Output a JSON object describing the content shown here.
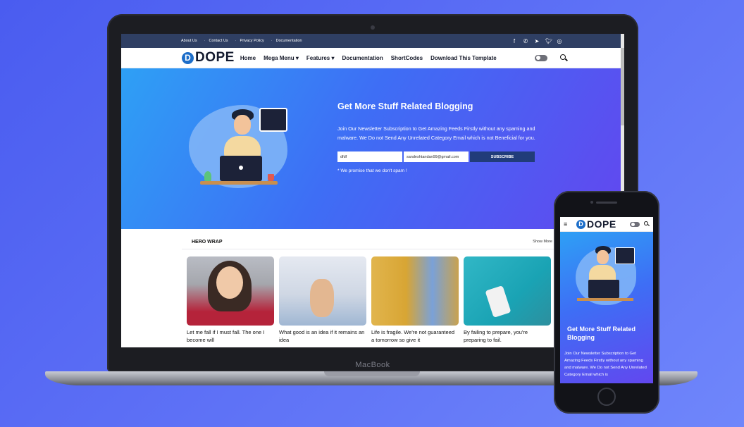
{
  "laptop": {
    "brand": "MacBook"
  },
  "site": {
    "topbar": {
      "links": [
        "About Us",
        "Contact Us",
        "Privacy Policy",
        "Documentation"
      ],
      "socials": [
        "facebook-icon",
        "whatsapp-icon",
        "telegram-icon",
        "twitter-icon",
        "instagram-icon"
      ]
    },
    "logo": {
      "mark": "D",
      "text": "DOPE"
    },
    "nav": [
      "Home",
      "Mega Menu ▾",
      "Features ▾",
      "Documentation",
      "ShortCodes",
      "Download This Template"
    ],
    "hero": {
      "title": "Get More Stuff Related Blogging",
      "text": "Join Our Newsletter Subscription to Get Amazing Feeds Firstly without any spaming and malware. We Do not Send Any Unrelated Category Email which is not Beneficial for you.",
      "name_value": "dfdf",
      "email_value": "sandeshtandan99@gmail.com",
      "subscribe_label": "SUBSCRIBE",
      "promise": "* We promise that we don't spam !"
    },
    "section": {
      "title": "HERO WRAP",
      "show_more": "Show More",
      "cards": [
        {
          "text": "Let me fall if I must fall. The one I become will"
        },
        {
          "text": "What good is an idea if it remains an idea"
        },
        {
          "text": "Life is fragile. We're not guaranteed a tomorrow so give it"
        },
        {
          "text": "By failing to prepare, you're preparing to fail."
        }
      ]
    },
    "colors": {
      "topbar": "#2f3f63",
      "accent": "#1d6ec9",
      "subscribe": "#213c7a"
    }
  },
  "phone": {
    "menu_icon": "≡",
    "logo": {
      "mark": "D",
      "text": "DOPE"
    },
    "hero": {
      "title": "Get More Stuff Related Blogging",
      "text": "Join Our Newsletter Subscription to Get Amazing Feeds Firstly without any spaming and malware. We Do not Send Any Unrelated Category Email which is"
    }
  }
}
